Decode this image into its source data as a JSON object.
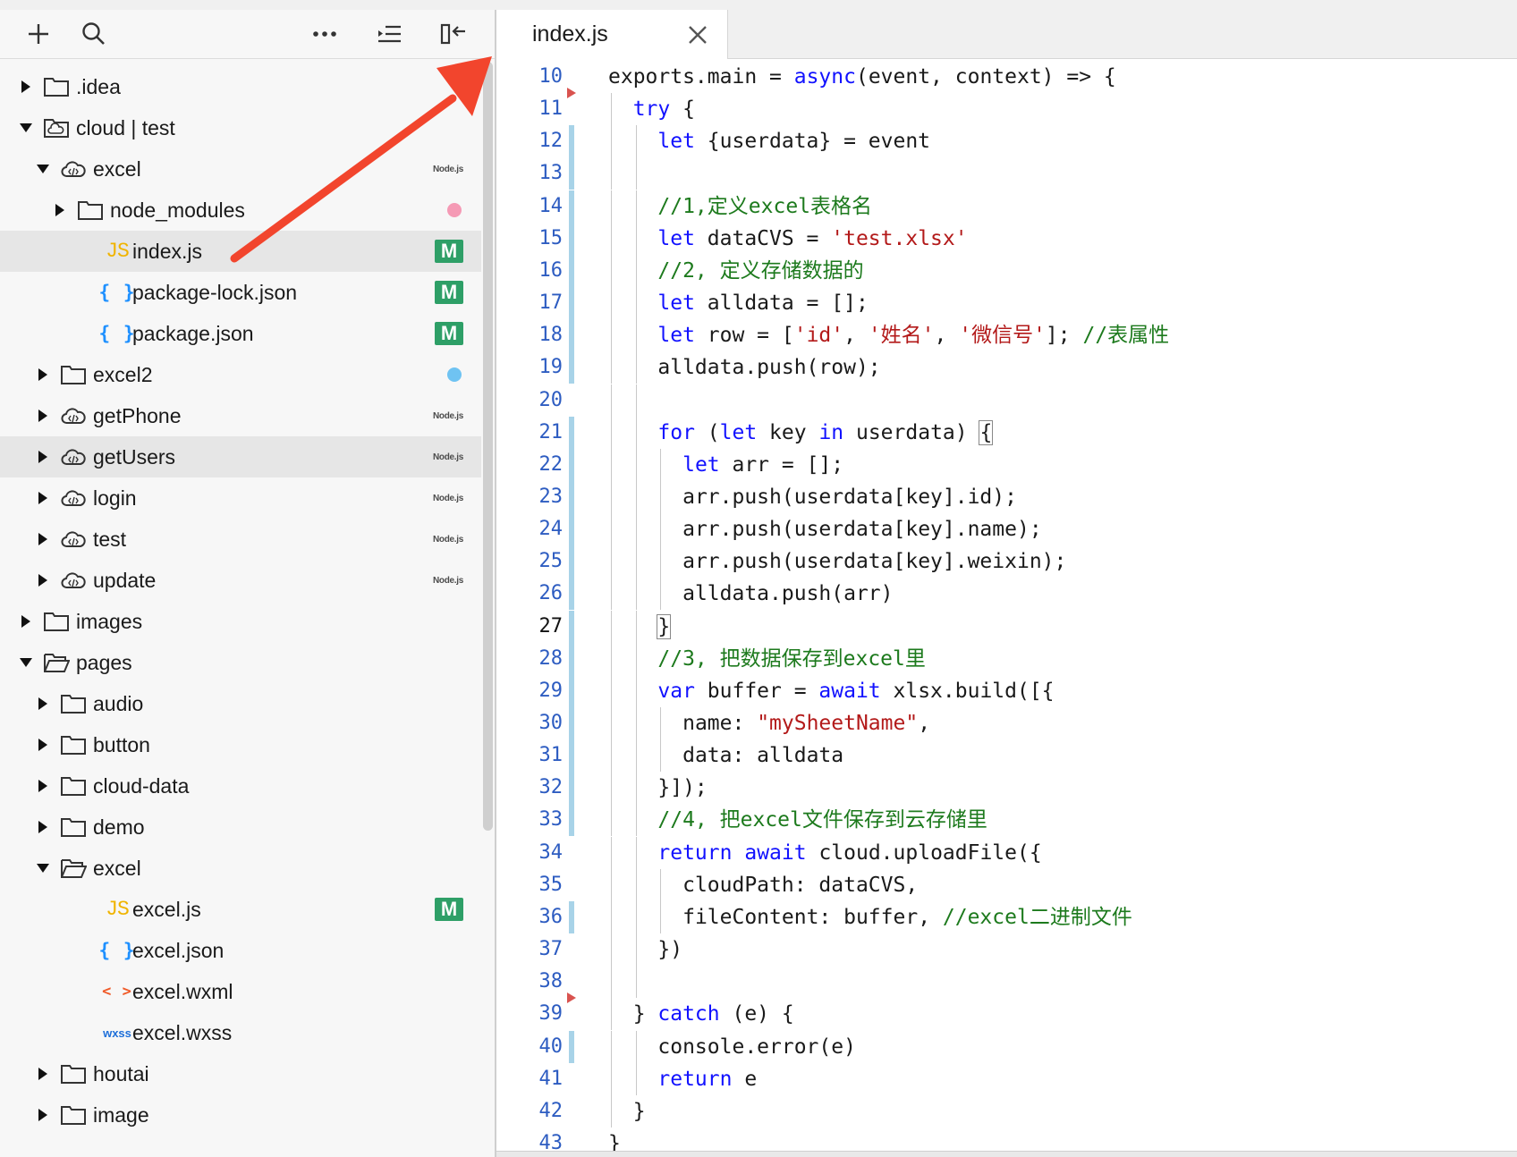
{
  "toolbar": {
    "icons": [
      "plus-icon",
      "search-icon",
      "more-icon",
      "outline-icon",
      "collapse-panel-icon"
    ]
  },
  "tree": [
    {
      "label": ".idea",
      "type": "folder",
      "expanded": false,
      "level": 0
    },
    {
      "label": "cloud | test",
      "type": "cloud-root",
      "expanded": true,
      "level": 0
    },
    {
      "label": "excel",
      "type": "cloud-function",
      "expanded": true,
      "level": 1,
      "badge": "Node.js"
    },
    {
      "label": "node_modules",
      "type": "folder",
      "expanded": false,
      "level": 2,
      "dot": "#f59ab5"
    },
    {
      "label": "index.js",
      "type": "js",
      "level": 2,
      "badge": "M",
      "selected": true
    },
    {
      "label": "package-lock.json",
      "type": "json",
      "level": 2,
      "badge": "M"
    },
    {
      "label": "package.json",
      "type": "json",
      "level": 2,
      "badge": "M"
    },
    {
      "label": "excel2",
      "type": "folder",
      "expanded": false,
      "level": 1,
      "dot": "#6fc3f2"
    },
    {
      "label": "getPhone",
      "type": "cloud-function",
      "expanded": false,
      "level": 1,
      "badge": "Node.js"
    },
    {
      "label": "getUsers",
      "type": "cloud-function",
      "expanded": false,
      "level": 1,
      "badge": "Node.js",
      "hover": true
    },
    {
      "label": "login",
      "type": "cloud-function",
      "expanded": false,
      "level": 1,
      "badge": "Node.js"
    },
    {
      "label": "test",
      "type": "cloud-function",
      "expanded": false,
      "level": 1,
      "badge": "Node.js"
    },
    {
      "label": "update",
      "type": "cloud-function",
      "expanded": false,
      "level": 1,
      "badge": "Node.js"
    },
    {
      "label": "images",
      "type": "folder",
      "expanded": false,
      "level": 0
    },
    {
      "label": "pages",
      "type": "folder",
      "expanded": true,
      "level": 0
    },
    {
      "label": "audio",
      "type": "folder",
      "expanded": false,
      "level": 1
    },
    {
      "label": "button",
      "type": "folder",
      "expanded": false,
      "level": 1
    },
    {
      "label": "cloud-data",
      "type": "folder",
      "expanded": false,
      "level": 1
    },
    {
      "label": "demo",
      "type": "folder",
      "expanded": false,
      "level": 1
    },
    {
      "label": "excel",
      "type": "folder",
      "expanded": true,
      "level": 1
    },
    {
      "label": "excel.js",
      "type": "js",
      "level": 2,
      "badge": "M"
    },
    {
      "label": "excel.json",
      "type": "json",
      "level": 2
    },
    {
      "label": "excel.wxml",
      "type": "wxml",
      "level": 2
    },
    {
      "label": "excel.wxss",
      "type": "wxss",
      "level": 2
    },
    {
      "label": "houtai",
      "type": "folder",
      "expanded": false,
      "level": 1
    },
    {
      "label": "image",
      "type": "folder",
      "expanded": false,
      "level": 1
    }
  ],
  "icon_text": {
    "js": "JS",
    "json": "{ }",
    "wxml": "< >",
    "wxss": "wxss"
  },
  "tab": {
    "label": "index.js",
    "close_icon": "close-icon"
  },
  "editor": {
    "current_line": 27,
    "lines": [
      {
        "n": 10,
        "indent": 0,
        "tokens": [
          [
            "t",
            "exports.main = "
          ],
          [
            "kw",
            "async"
          ],
          [
            "t",
            "(event, context) => {"
          ]
        ]
      },
      {
        "n": 11,
        "indent": 1,
        "tokens": [
          [
            "kw",
            "try"
          ],
          [
            "t",
            " {"
          ]
        ],
        "fold": true
      },
      {
        "n": 12,
        "indent": 2,
        "tokens": [
          [
            "kw",
            "let"
          ],
          [
            "t",
            " {userdata} = event"
          ]
        ],
        "mark": true
      },
      {
        "n": 13,
        "indent": 2,
        "tokens": [],
        "mark": true
      },
      {
        "n": 14,
        "indent": 2,
        "tokens": [
          [
            "cm",
            "//1,定义excel表格名"
          ]
        ],
        "mark": true
      },
      {
        "n": 15,
        "indent": 2,
        "tokens": [
          [
            "kw",
            "let"
          ],
          [
            "t",
            " dataCVS = "
          ],
          [
            "str",
            "'test.xlsx'"
          ]
        ],
        "mark": true
      },
      {
        "n": 16,
        "indent": 2,
        "tokens": [
          [
            "cm",
            "//2, 定义存储数据的"
          ]
        ],
        "mark": true
      },
      {
        "n": 17,
        "indent": 2,
        "tokens": [
          [
            "kw",
            "let"
          ],
          [
            "t",
            " alldata = [];"
          ]
        ],
        "mark": true
      },
      {
        "n": 18,
        "indent": 2,
        "tokens": [
          [
            "kw",
            "let"
          ],
          [
            "t",
            " row = ["
          ],
          [
            "str",
            "'id'"
          ],
          [
            "t",
            ", "
          ],
          [
            "str",
            "'姓名'"
          ],
          [
            "t",
            ", "
          ],
          [
            "str",
            "'微信号'"
          ],
          [
            "t",
            "]; "
          ],
          [
            "cm",
            "//表属性"
          ]
        ],
        "mark": true
      },
      {
        "n": 19,
        "indent": 2,
        "tokens": [
          [
            "t",
            "alldata.push(row);"
          ]
        ],
        "mark": true
      },
      {
        "n": 20,
        "indent": 2,
        "tokens": []
      },
      {
        "n": 21,
        "indent": 2,
        "tokens": [
          [
            "kw",
            "for"
          ],
          [
            "t",
            " ("
          ],
          [
            "kw",
            "let"
          ],
          [
            "t",
            " key "
          ],
          [
            "kw",
            "in"
          ],
          [
            "t",
            " userdata) "
          ],
          [
            "bx",
            "{"
          ]
        ],
        "mark": true
      },
      {
        "n": 22,
        "indent": 3,
        "tokens": [
          [
            "kw",
            "let"
          ],
          [
            "t",
            " arr = [];"
          ]
        ],
        "mark": true
      },
      {
        "n": 23,
        "indent": 3,
        "tokens": [
          [
            "t",
            "arr.push(userdata[key].id);"
          ]
        ],
        "mark": true
      },
      {
        "n": 24,
        "indent": 3,
        "tokens": [
          [
            "t",
            "arr.push(userdata[key].name);"
          ]
        ],
        "mark": true
      },
      {
        "n": 25,
        "indent": 3,
        "tokens": [
          [
            "t",
            "arr.push(userdata[key].weixin);"
          ]
        ],
        "mark": true
      },
      {
        "n": 26,
        "indent": 3,
        "tokens": [
          [
            "t",
            "alldata.push(arr)"
          ]
        ],
        "mark": true
      },
      {
        "n": 27,
        "indent": 2,
        "tokens": [
          [
            "bx",
            "}"
          ]
        ],
        "mark": true
      },
      {
        "n": 28,
        "indent": 2,
        "tokens": [
          [
            "cm",
            "//3, 把数据保存到excel里"
          ]
        ],
        "mark": true
      },
      {
        "n": 29,
        "indent": 2,
        "tokens": [
          [
            "kw",
            "var"
          ],
          [
            "t",
            " buffer = "
          ],
          [
            "kw",
            "await"
          ],
          [
            "t",
            " xlsx.build([{"
          ]
        ],
        "mark": true
      },
      {
        "n": 30,
        "indent": 3,
        "tokens": [
          [
            "t",
            "name: "
          ],
          [
            "str",
            "\"mySheetName\""
          ],
          [
            "t",
            ","
          ]
        ],
        "mark": true
      },
      {
        "n": 31,
        "indent": 3,
        "tokens": [
          [
            "t",
            "data: alldata"
          ]
        ],
        "mark": true
      },
      {
        "n": 32,
        "indent": 2,
        "tokens": [
          [
            "t",
            "}]);"
          ]
        ],
        "mark": true
      },
      {
        "n": 33,
        "indent": 2,
        "tokens": [
          [
            "cm",
            "//4, 把excel文件保存到云存储里"
          ]
        ],
        "mark": true
      },
      {
        "n": 34,
        "indent": 2,
        "tokens": [
          [
            "kw",
            "return"
          ],
          [
            "t",
            " "
          ],
          [
            "kw",
            "await"
          ],
          [
            "t",
            " cloud.uploadFile({"
          ]
        ]
      },
      {
        "n": 35,
        "indent": 3,
        "tokens": [
          [
            "t",
            "cloudPath: dataCVS,"
          ]
        ]
      },
      {
        "n": 36,
        "indent": 3,
        "tokens": [
          [
            "t",
            "fileContent: buffer, "
          ],
          [
            "cm",
            "//excel二进制文件"
          ]
        ],
        "mark": true
      },
      {
        "n": 37,
        "indent": 2,
        "tokens": [
          [
            "t",
            "})"
          ]
        ]
      },
      {
        "n": 38,
        "indent": 2,
        "tokens": []
      },
      {
        "n": 39,
        "indent": 1,
        "tokens": [
          [
            "t",
            "} "
          ],
          [
            "kw",
            "catch"
          ],
          [
            "t",
            " (e) {"
          ]
        ],
        "fold": true
      },
      {
        "n": 40,
        "indent": 2,
        "tokens": [
          [
            "t",
            "console.error(e)"
          ]
        ],
        "mark": true
      },
      {
        "n": 41,
        "indent": 2,
        "tokens": [
          [
            "kw",
            "return"
          ],
          [
            "t",
            " e"
          ]
        ]
      },
      {
        "n": 42,
        "indent": 1,
        "tokens": [
          [
            "t",
            "}"
          ]
        ]
      },
      {
        "n": 43,
        "indent": 0,
        "tokens": [
          [
            "t",
            "}"
          ]
        ]
      }
    ]
  },
  "colors": {
    "keyword": "#1212ff",
    "string": "#b31a1a",
    "comment": "#1d7a1d",
    "line_number": "#2d5cc1",
    "modified_badge": "#2e9f67",
    "annotation_arrow": "#f2452d"
  }
}
